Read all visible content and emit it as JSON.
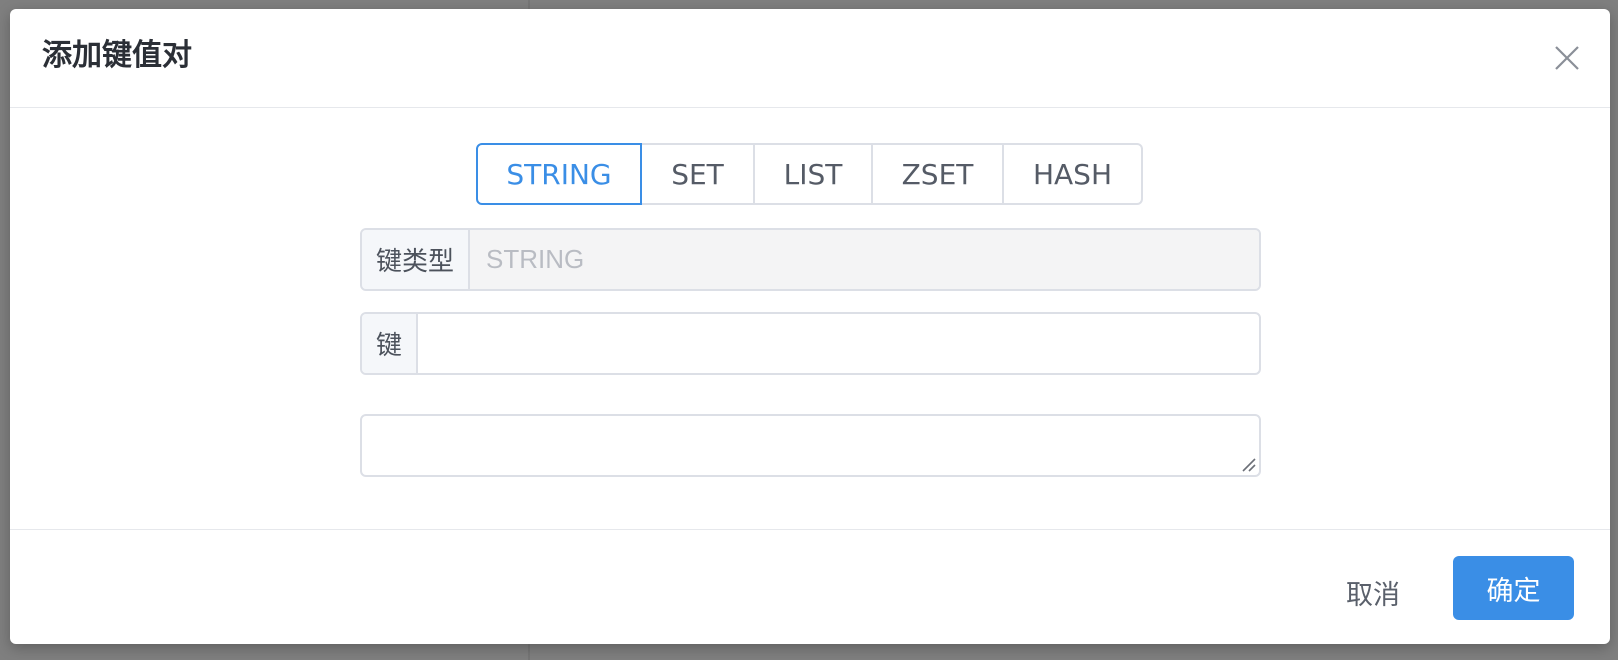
{
  "dialog": {
    "title": "添加键值对",
    "close_icon": "close-icon"
  },
  "type_tabs": [
    {
      "label": "STRING",
      "selected": true
    },
    {
      "label": "SET",
      "selected": false
    },
    {
      "label": "LIST",
      "selected": false
    },
    {
      "label": "ZSET",
      "selected": false
    },
    {
      "label": "HASH",
      "selected": false
    }
  ],
  "key_type": {
    "label": "键类型",
    "value": "STRING"
  },
  "key": {
    "label": "键",
    "value": ""
  },
  "value": {
    "value": ""
  },
  "footer": {
    "cancel_label": "取消",
    "confirm_label": "确定"
  },
  "colors": {
    "accent": "#3a8ee6",
    "border": "#dcdfe6",
    "overlay": "#7f7f7f"
  }
}
